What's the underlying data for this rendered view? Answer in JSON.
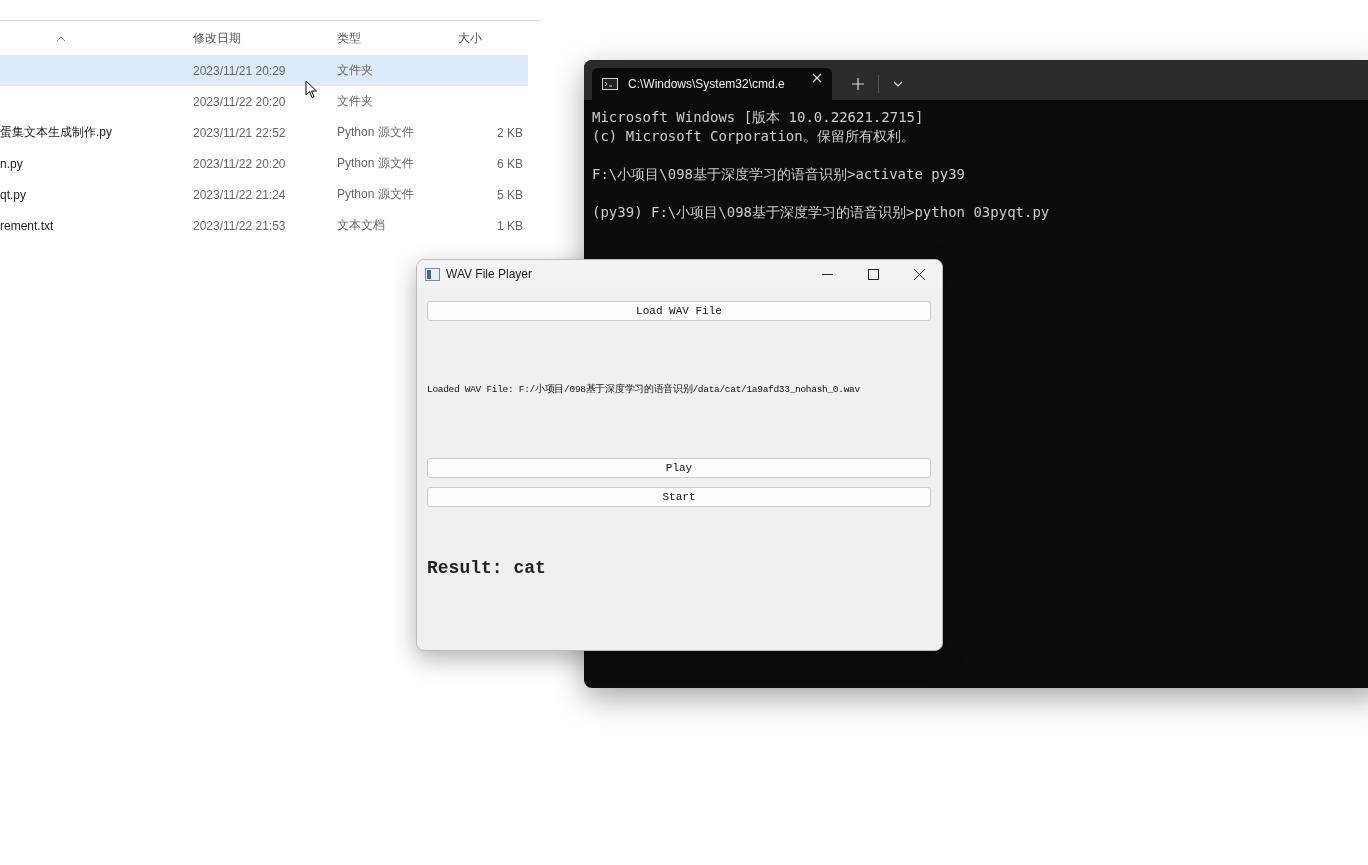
{
  "explorer": {
    "columns": [
      {
        "label": "修改日期"
      },
      {
        "label": "类型"
      },
      {
        "label": "大小"
      }
    ],
    "rows": [
      {
        "date": "2023/11/21 20:29",
        "type": "文件夹",
        "selected": true
      },
      {
        "date": "2023/11/22 20:20",
        "type": "文件夹",
        "selected": false
      },
      {
        "name": "蛋集文本生成制作.py",
        "date": "2023/11/21 22:52",
        "type": "Python 源文件",
        "size": "2 KB",
        "selected": false
      },
      {
        "name": "n.py",
        "date": "2023/11/22 20:20",
        "type": "Python 源文件",
        "size": "6 KB",
        "selected": false
      },
      {
        "name": "qt.py",
        "date": "2023/11/22 21:24",
        "type": "Python 源文件",
        "size": "5 KB",
        "selected": false
      },
      {
        "name": "rement.txt",
        "date": "2023/11/22 21:53",
        "type": "文本文档",
        "size": "1 KB",
        "selected": false
      }
    ]
  },
  "terminal": {
    "tab_title": "C:\\Windows\\System32\\cmd.e",
    "blocks": [
      {
        "lines": [
          "Microsoft Windows [版本 10.0.22621.2715]",
          "(c) Microsoft Corporation。保留所有权利。"
        ]
      },
      {
        "lines": [
          "F:\\小项目\\098基于深度学习的语音识别>activate py39"
        ]
      },
      {
        "lines": [
          "(py39) F:\\小项目\\098基于深度学习的语音识别>python 03pyqt.py"
        ]
      }
    ]
  },
  "player": {
    "title": "WAV File Player",
    "load_button": "Load WAV File",
    "loaded_label": "Loaded WAV File: F:/小项目/098基于深度学习的语音识别/data/cat/1a9afd33_nohash_0.wav",
    "buttons": [
      "Play",
      "Start"
    ],
    "result": "Result: cat"
  }
}
